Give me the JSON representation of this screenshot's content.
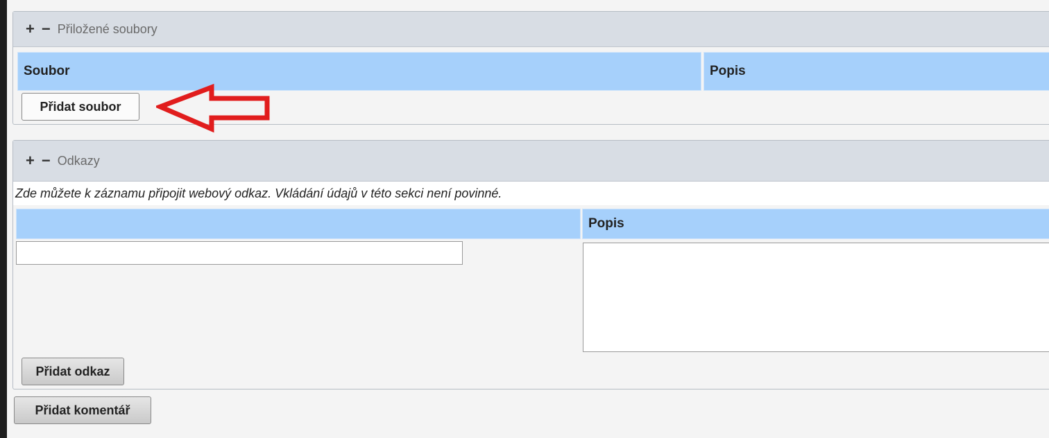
{
  "files_section": {
    "title": "Přiložené soubory",
    "expand": "+",
    "collapse": "−",
    "col_file": "Soubor",
    "col_desc": "Popis",
    "add_button": "Přidat soubor"
  },
  "links_section": {
    "title": "Odkazy",
    "expand": "+",
    "collapse": "−",
    "note": "Zde můžete k záznamu připojit webový odkaz. Vkládání údajů v této sekci není povinné.",
    "col_url": "",
    "col_desc": "Popis",
    "url_value": "",
    "desc_value": "",
    "add_button": "Přidat odkaz"
  },
  "add_comment_button": "Přidat komentář",
  "annotation": {
    "arrow_color": "#e11d1d"
  }
}
